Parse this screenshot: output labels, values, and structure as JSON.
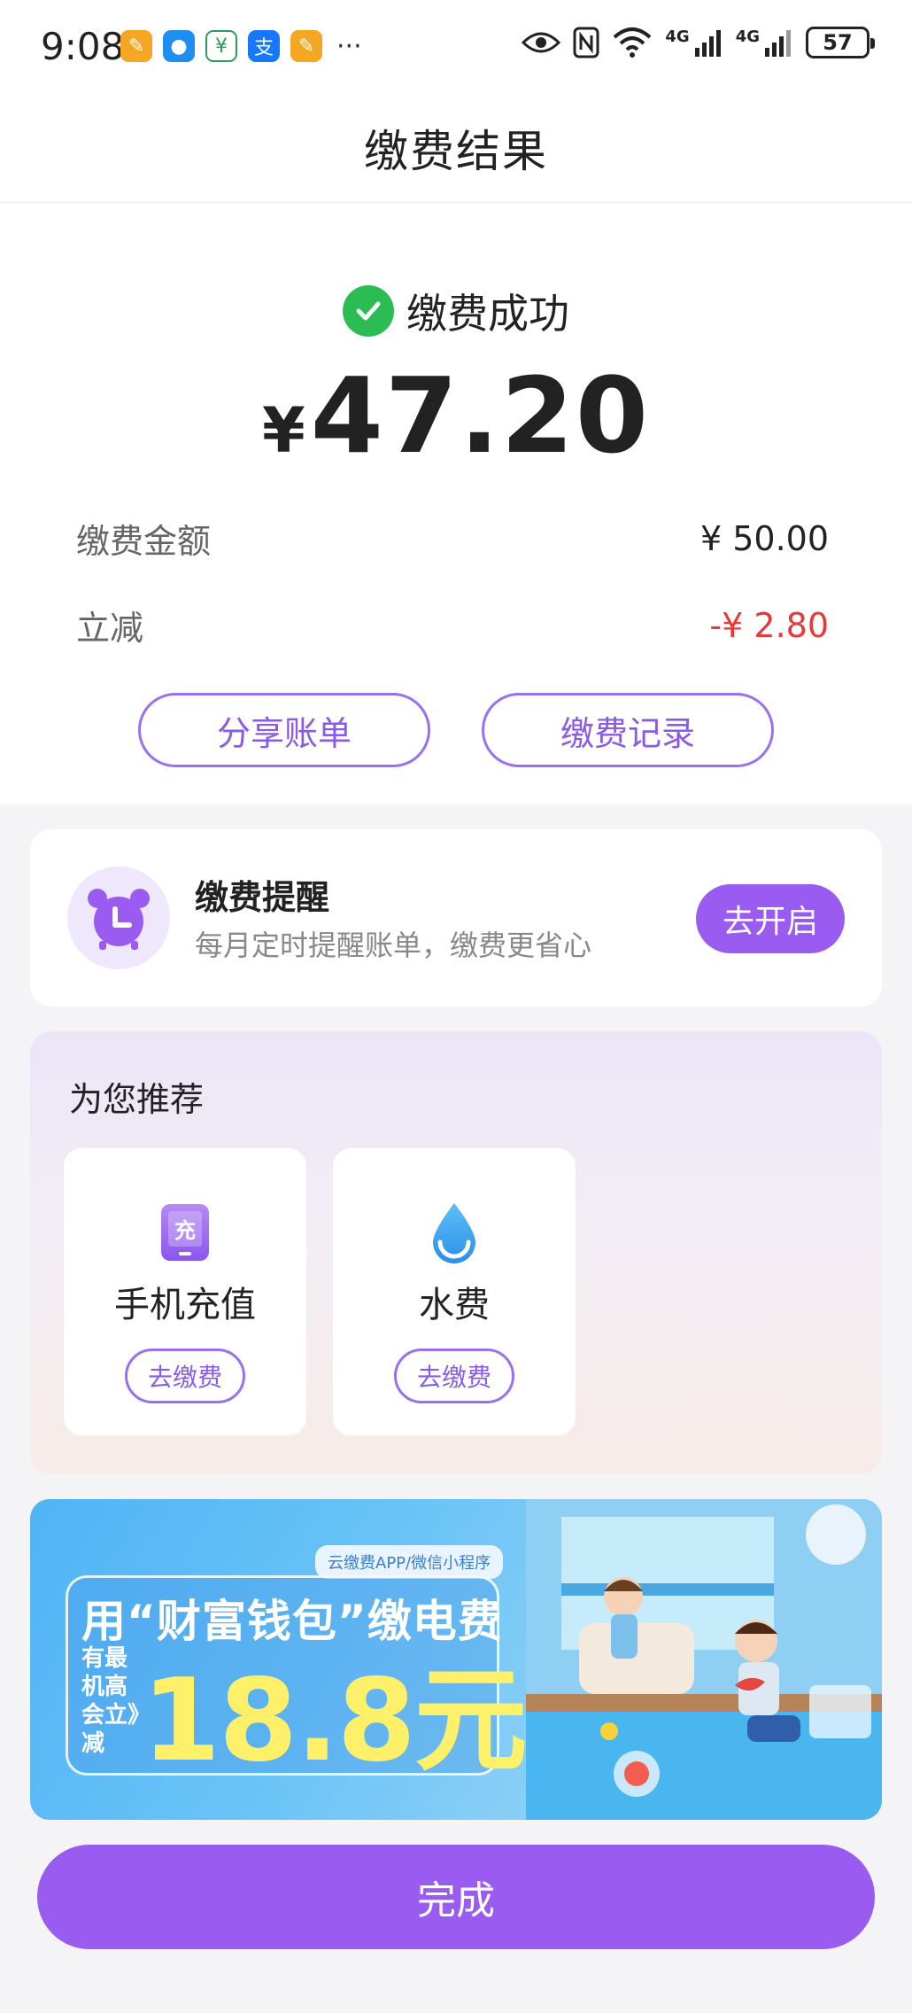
{
  "status_bar": {
    "time": "9:08",
    "more": "···",
    "battery": "57",
    "signal_a": "4G",
    "signal_b": "4G"
  },
  "header": {
    "title": "缴费结果"
  },
  "result": {
    "status_text": "缴费成功",
    "currency": "¥",
    "amount": "47.20",
    "rows": [
      {
        "label": "缴费金额",
        "value": "¥ 50.00"
      },
      {
        "label": "立减",
        "value": "-¥ 2.80"
      }
    ],
    "share_button": "分享账单",
    "records_button": "缴费记录"
  },
  "reminder": {
    "title": "缴费提醒",
    "subtitle": "每月定时提醒账单，缴费更省心",
    "button": "去开启"
  },
  "recommend": {
    "title": "为您推荐",
    "items": [
      {
        "label": "手机充值",
        "icon": "phone-recharge-icon",
        "button": "去缴费"
      },
      {
        "label": "水费",
        "icon": "water-drop-icon",
        "button": "去缴费"
      }
    ]
  },
  "banner": {
    "tag": "云缴费APP/微信小程序",
    "headline": "用“财富钱包”缴电费",
    "small": "有最机高会立》减",
    "big": "18.8元"
  },
  "footer": {
    "done_button": "完成"
  },
  "colors": {
    "accent": "#9a5cf0",
    "success": "#2bbd53",
    "discount": "#e8393a"
  }
}
